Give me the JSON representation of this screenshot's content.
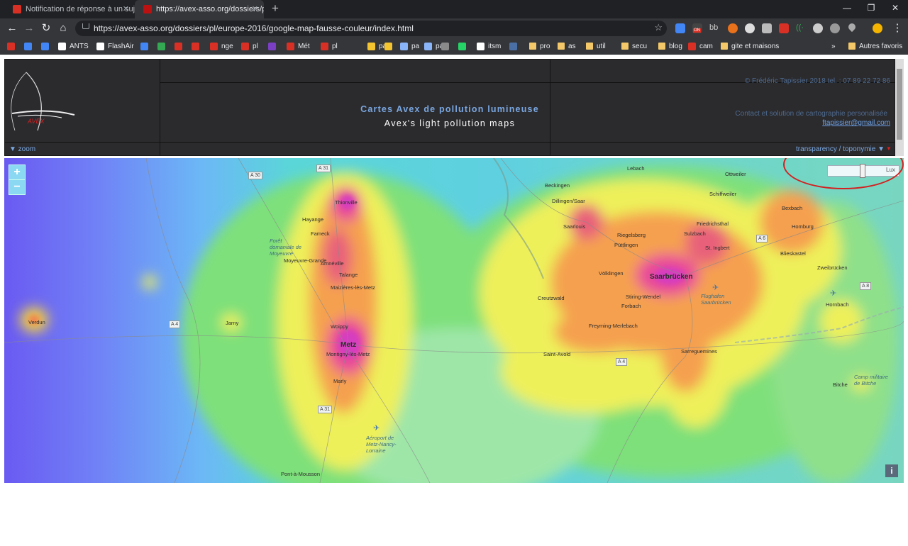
{
  "browser": {
    "tabs": [
      {
        "label": "Notification de réponse à un suje",
        "icon": "gmail-icon",
        "active": false
      },
      {
        "label": "https://avex-asso.org/dossiers/pl",
        "icon": "avex-icon",
        "active": true
      }
    ],
    "new_tab": "+",
    "window_controls": {
      "minimize": "—",
      "restore": "❐",
      "close": "✕"
    },
    "url": "https://avex-asso.org/dossiers/pl/europe-2016/google-map-fausse-couleur/index.html",
    "extension_badge": "ON",
    "extension_text_bb": "bb",
    "bookmarks": [
      {
        "label": "",
        "icon": "gmail-icon",
        "color": "#d93025"
      },
      {
        "label": "",
        "icon": "calendar-icon",
        "color": "#4285f4"
      },
      {
        "label": "",
        "icon": "doc4-icon",
        "color": "#4285f4"
      },
      {
        "label": "ANTS",
        "icon": "ants-icon",
        "color": "#ffffff"
      },
      {
        "label": "FlashAir",
        "icon": "page-icon",
        "color": "#ffffff"
      },
      {
        "label": "",
        "icon": "translate-icon",
        "color": "#4285f4"
      },
      {
        "label": "",
        "icon": "maps-icon",
        "color": "#34a853"
      },
      {
        "label": "",
        "icon": "gmail-icon",
        "color": "#d93025"
      },
      {
        "label": "",
        "icon": "avex-icon",
        "color": "#d93025"
      },
      {
        "label": "nge",
        "icon": "avex-icon",
        "color": "#d93025"
      },
      {
        "label": "pl",
        "icon": "avex-icon",
        "color": "#d93025"
      },
      {
        "label": "",
        "icon": "purple-icon",
        "color": "#7b3fc4"
      },
      {
        "label": "Mét",
        "icon": "avex-icon",
        "color": "#d93025"
      },
      {
        "label": "pl",
        "icon": "avex-icon",
        "color": "#d93025"
      },
      {
        "label": "pa",
        "icon": "yellow-icon",
        "color": "#f4c430"
      },
      {
        "label": "",
        "icon": "yellow-icon",
        "color": "#f4c430"
      },
      {
        "label": "pa",
        "icon": "satellite-icon",
        "color": "#8ab4f8"
      },
      {
        "label": "pa",
        "icon": "satellite-icon",
        "color": "#8ab4f8"
      },
      {
        "label": "",
        "icon": "photo-icon",
        "color": "#8a8a8a"
      },
      {
        "label": "",
        "icon": "whatsapp-icon",
        "color": "#25d366"
      },
      {
        "label": "itsm",
        "icon": "page-icon",
        "color": "#ffffff"
      },
      {
        "label": "",
        "icon": "portal-icon",
        "color": "#4a6fa5"
      },
      {
        "label": "pro",
        "icon": "folder-icon",
        "color": "#f4c868"
      },
      {
        "label": "as",
        "icon": "folder-icon",
        "color": "#f4c868"
      },
      {
        "label": "util",
        "icon": "folder-icon",
        "color": "#f4c868"
      },
      {
        "label": "secu",
        "icon": "folder-icon",
        "color": "#f4c868"
      },
      {
        "label": "blog",
        "icon": "folder-icon",
        "color": "#f4c868"
      },
      {
        "label": "cam",
        "icon": "avex-icon",
        "color": "#d93025"
      },
      {
        "label": "gite et maisons",
        "icon": "folder-icon",
        "color": "#f4c868"
      }
    ],
    "bookmarks_overflow": "»",
    "other_bookmarks": "Autres favoris"
  },
  "site": {
    "logo_text": "AVEX",
    "title_fr": "Cartes Avex de pollution lumineuse",
    "title_en": "Avex's light pollution maps",
    "copyright": "© Frédéric Tapissier 2018  tel. : 07 89 22 72 86",
    "contact": "Contact et solution de cartographie personalisée",
    "email": "ftapissier@gmail.com",
    "zoom_label": "▼ zoom",
    "transparency_label": "transparency / toponymie ▼"
  },
  "map": {
    "zoom_in": "+",
    "zoom_out": "−",
    "slider_text": "Lux",
    "info": "i",
    "towns": [
      "Thionville",
      "Hayange",
      "Fameck",
      "Forêt domaniale de Moyeuvre",
      "Moyeuvre-Grande",
      "Amnéville",
      "Talange",
      "Maizières-lès-Metz",
      "Woippy",
      "Metz",
      "Montigny-lès-Metz",
      "Marly",
      "Verdun",
      "Jarny",
      "Pont-à-Mousson",
      "Aéroport de Metz-Nancy-Lorraine",
      "Beckingen",
      "Dillingen/Saar",
      "Saarlouis",
      "Riegelsberg",
      "Püttlingen",
      "Völklingen",
      "Saarbrücken",
      "Creutzwald",
      "Stiring-Wendel",
      "Forbach",
      "Freyming-Merlebach",
      "Saint-Avold",
      "Sarreguemines",
      "Lebach",
      "Ottweiler",
      "Schiffweiler",
      "Friedrichsthal",
      "Sulzbach",
      "St. Ingbert",
      "Bexbach",
      "Homburg",
      "Blieskastel",
      "Zweibrücken",
      "Hornbach",
      "Flughafen Saarbrücken",
      "Bitche",
      "Camp militaire de Bitche"
    ],
    "roads": [
      "A 30",
      "A 31",
      "A 4",
      "A 31",
      "A 4",
      "A 6",
      "A 8"
    ]
  }
}
